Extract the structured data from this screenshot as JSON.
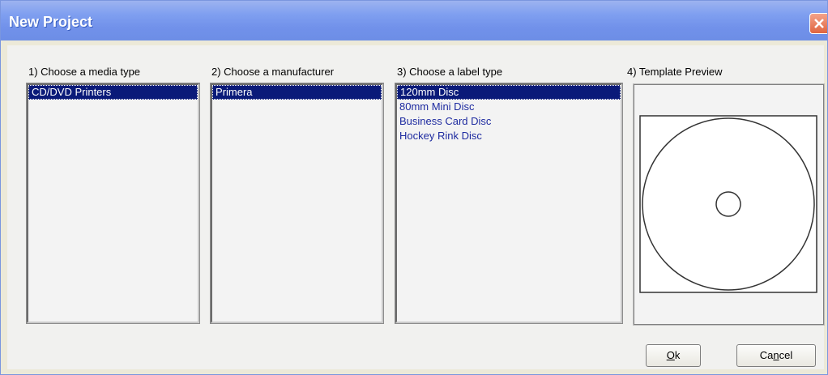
{
  "window": {
    "title": "New Project"
  },
  "columns": [
    {
      "label": "1) Choose a media type",
      "items": [
        "CD/DVD Printers"
      ],
      "selected": 0
    },
    {
      "label": "2) Choose a manufacturer",
      "items": [
        "Primera"
      ],
      "selected": 0
    },
    {
      "label": "3) Choose a label type",
      "items": [
        "120mm Disc",
        "80mm Mini Disc",
        "Business Card Disc",
        "Hockey Rink Disc"
      ],
      "selected": 0
    }
  ],
  "preview": {
    "label": "4) Template Preview"
  },
  "buttons": {
    "ok_mnemonic": "O",
    "ok_rest": "k",
    "cancel_pre": "Ca",
    "cancel_mnemonic": "n",
    "cancel_rest": "cel"
  },
  "icons": {
    "close": "close-icon"
  },
  "colors": {
    "selection": "#0a1a79",
    "item_text": "#1e2ba0",
    "titlebar": "#7f9ff0"
  }
}
